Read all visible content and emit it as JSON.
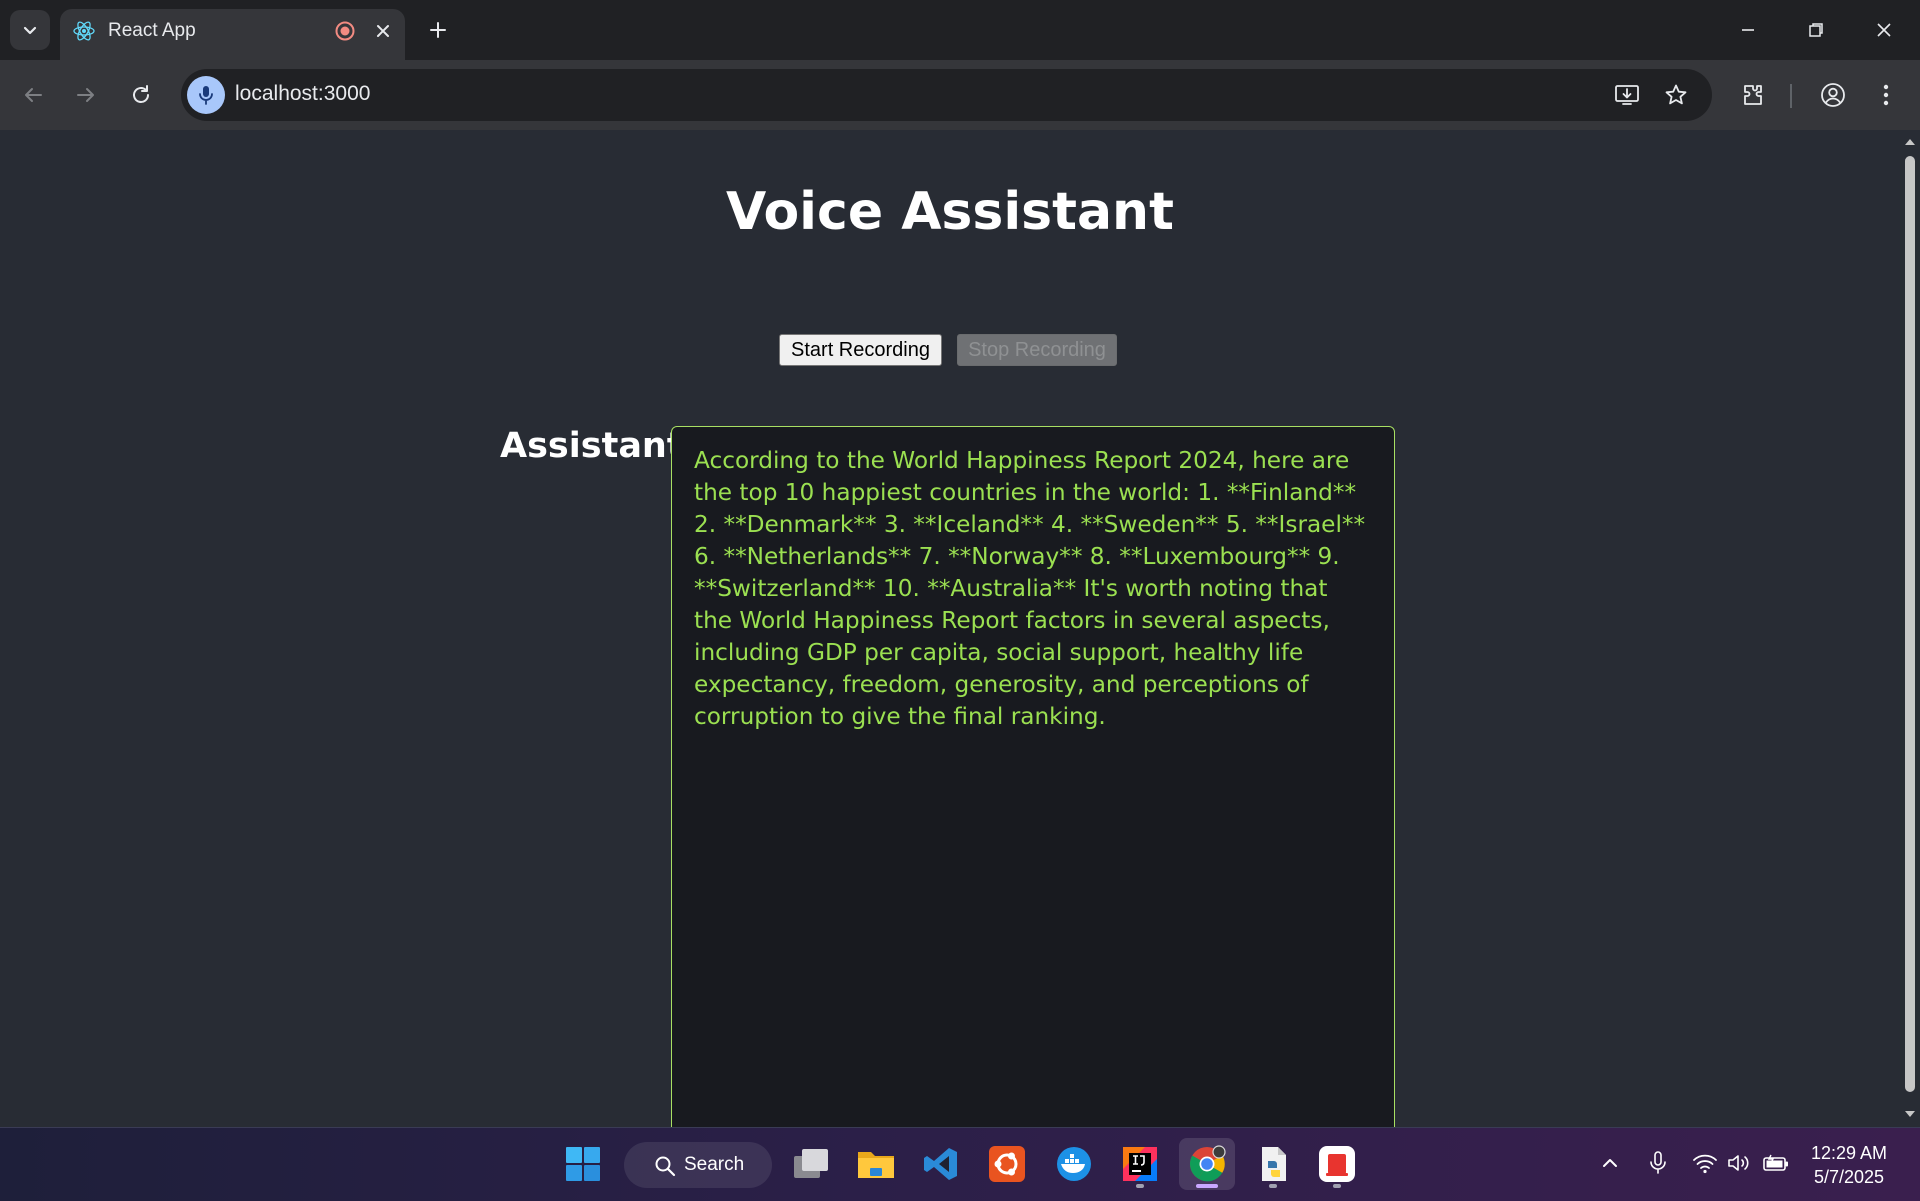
{
  "browser": {
    "tab_title": "React App",
    "url": "localhost:3000"
  },
  "page": {
    "title": "Voice Assistant",
    "start_label": "Start Recording",
    "stop_label": "Stop Recording",
    "assistant_label": "Assistant:",
    "response_text": "According to the World Happiness Report 2024, here are the top 10 happiest countries in the world: 1. **Finland** 2. **Denmark** 3. **Iceland** 4. **Sweden** 5. **Israel** 6. **Netherlands** 7. **Norway** 8. **Luxembourg** 9. **Switzerland** 10. **Australia** It's worth noting that the World Happiness Report factors in several aspects, including GDP per capita, social support, healthy life expectancy, freedom, generosity, and perceptions of corruption to give the final ranking."
  },
  "taskbar": {
    "search_label": "Search",
    "time": "12:29 AM",
    "date": "5/7/2025",
    "apps": [
      "start-icon",
      "task-view-icon",
      "file-explorer-icon",
      "vscode-icon",
      "ubuntu-icon",
      "docker-icon",
      "intellij-icon",
      "chrome-icon",
      "python-icon",
      "app-icon"
    ]
  },
  "colors": {
    "page_bg": "#282c34",
    "response_text": "#9be051",
    "response_border": "#a8e063",
    "chrome_dark": "#202124",
    "chrome_toolbar": "#35363a"
  }
}
